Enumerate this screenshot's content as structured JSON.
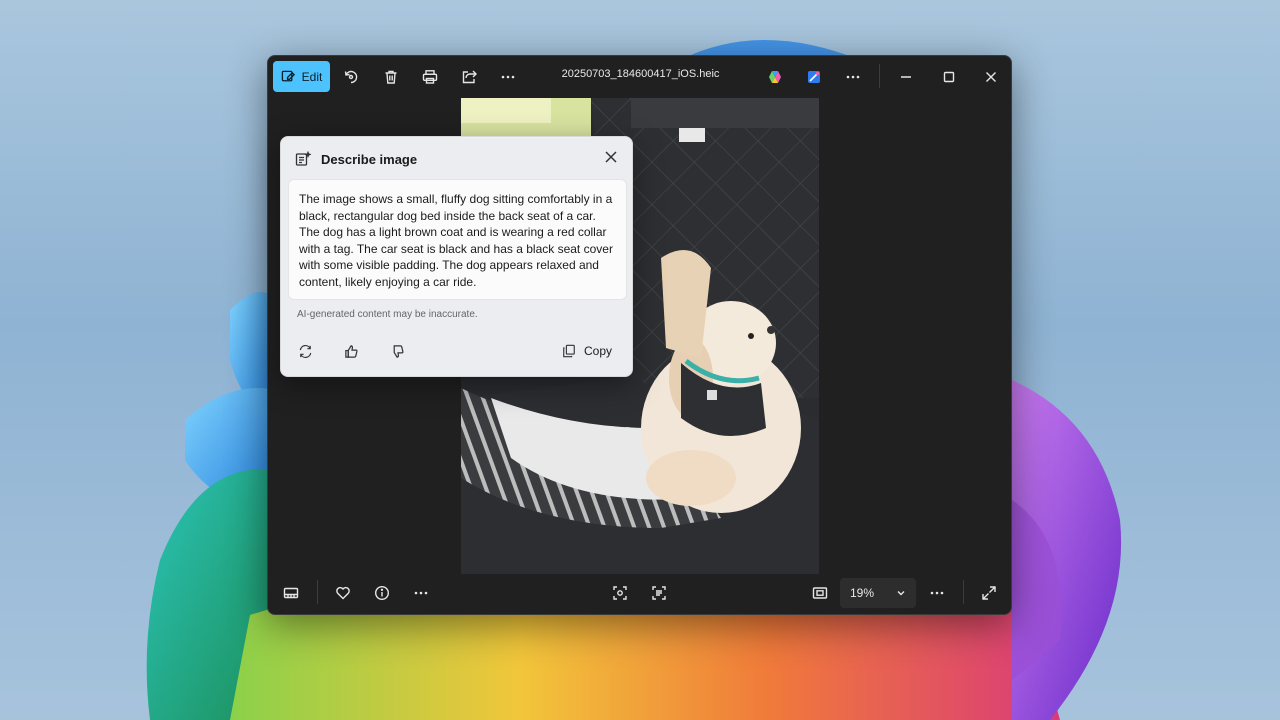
{
  "window": {
    "filename": "20250703_184600417_iOS.heic"
  },
  "toolbar": {
    "edit_label": "Edit",
    "icons": [
      "edit-icon",
      "rotate-icon",
      "delete-icon",
      "print-icon",
      "share-icon",
      "more-icon",
      "copilot-icon",
      "designer-icon",
      "more-icon",
      "minimize-icon",
      "maximize-icon",
      "close-icon"
    ]
  },
  "bottombar": {
    "zoom_value": "19%",
    "icons": [
      "filmstrip-icon",
      "favorite-icon",
      "info-icon",
      "more-icon",
      "visual-search-icon",
      "text-scan-icon",
      "fit-icon",
      "more-icon",
      "fullscreen-icon"
    ]
  },
  "describe_popup": {
    "title": "Describe image",
    "description": "The image shows a small, fluffy dog sitting comfortably in a black, rectangular dog bed inside the back seat of a car. The dog has a light brown coat and is wearing a red collar with a tag. The car seat is black and has a black seat cover with some visible padding. The dog appears relaxed and content, likely enjoying a car ride.",
    "disclaimer": "AI-generated content may be inaccurate.",
    "copy_label": "Copy"
  },
  "colors": {
    "accent": "#4cc2ff",
    "window_bg": "#202020",
    "popup_bg": "#f2f4f7"
  }
}
